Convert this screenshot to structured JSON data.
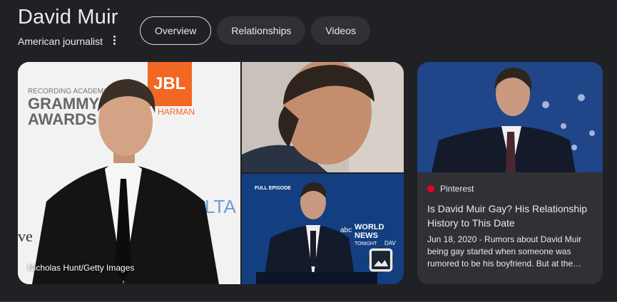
{
  "entity": {
    "name": "David Muir",
    "description": "American journalist"
  },
  "tabs": [
    {
      "label": "Overview",
      "active": true
    },
    {
      "label": "Relationships",
      "active": false
    },
    {
      "label": "Videos",
      "active": false
    }
  ],
  "images": {
    "main_credit": "Nicholas Hunt/Getty Images",
    "backdrop_words": [
      "RECORDING ACADEMY",
      "GRAMMY",
      "AWARDS",
      "JBL",
      "HARMAN",
      "LTA",
      "ve"
    ],
    "broadcast_words": [
      "FULL EPISODE",
      "abc",
      "WORLD",
      "NEWS",
      "TONIGHT",
      "DAV"
    ]
  },
  "result_card": {
    "source": "Pinterest",
    "title": "Is David Muir Gay? His Relationship History to This Date",
    "snippet": "Jun 18, 2020 - Rumors about David Muir being gay started when someone was rumored to be his boyfriend. But at the…"
  },
  "icons": {
    "more": "more-vert-icon",
    "image_search": "image-icon",
    "source": "pinterest-icon"
  },
  "colors": {
    "background": "#202124",
    "chip": "#303134",
    "text": "#e8eaed",
    "pinterest": "#e60023",
    "jbl": "#f26722"
  }
}
